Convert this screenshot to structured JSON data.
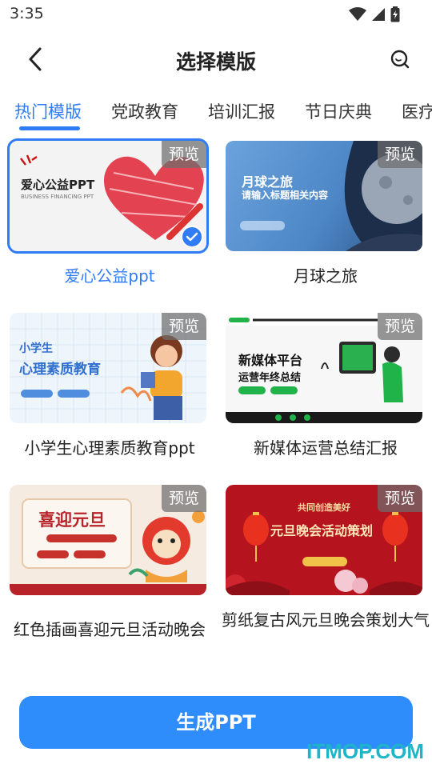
{
  "status_bar": {
    "time": "3:35"
  },
  "header": {
    "title": "选择模版"
  },
  "tabs": [
    {
      "label": "热门模版",
      "active": true
    },
    {
      "label": "党政教育",
      "active": false
    },
    {
      "label": "培训汇报",
      "active": false
    },
    {
      "label": "节日庆典",
      "active": false
    },
    {
      "label": "医疗",
      "active": false
    }
  ],
  "preview_label": "预览",
  "templates": [
    {
      "title": "爱心公益ppt",
      "selected": true,
      "slide": {
        "heading": "爱心公益PPT",
        "sub": "BUSINESS FINANCING PPT"
      }
    },
    {
      "title": "月球之旅",
      "selected": false,
      "slide": {
        "heading": "月球之旅",
        "sub": "请输入标题相关内容"
      }
    },
    {
      "title": "小学生心理素质教育ppt",
      "selected": false,
      "slide": {
        "heading": "小学生",
        "sub": "心理素质教育"
      }
    },
    {
      "title": "新媒体运营总结汇报",
      "selected": false,
      "slide": {
        "heading": "新媒体平台",
        "sub": "运营年终总结"
      }
    },
    {
      "title": "红色插画喜迎元旦活动晚会",
      "selected": false,
      "slide": {
        "heading": "喜迎元旦"
      }
    },
    {
      "title": "剪纸复古风元旦晚会策划大气",
      "selected": false,
      "slide": {
        "heading": "共同创造美好",
        "sub": "元旦晚会活动策划"
      }
    }
  ],
  "generate_button": "生成PPT",
  "watermark": "ITMOP.COM",
  "colors": {
    "accent": "#2f7cf6",
    "button": "#2f8cfb",
    "watermark": "#1fb5c8"
  }
}
